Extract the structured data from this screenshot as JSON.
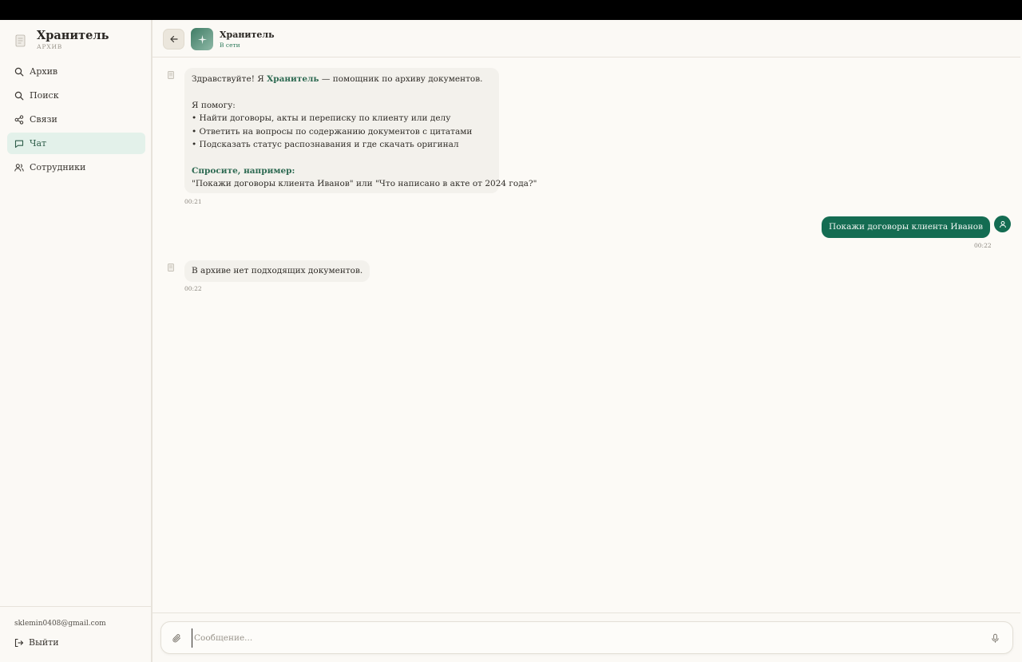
{
  "sidebar": {
    "brand_title": "Хранитель",
    "brand_subtitle": "АРХИВ",
    "nav": [
      {
        "label": "Архив",
        "icon": "search-icon"
      },
      {
        "label": "Поиск",
        "icon": "search-icon"
      },
      {
        "label": "Связи",
        "icon": "share-nodes-icon"
      },
      {
        "label": "Чат",
        "icon": "chat-bubble-icon",
        "active": true
      },
      {
        "label": "Сотрудники",
        "icon": "users-icon"
      }
    ],
    "user_email": "sklemin0408@gmail.com",
    "logout_label": "Выйти"
  },
  "header": {
    "bot_name": "Хранитель",
    "bot_status": "В сети"
  },
  "messages": [
    {
      "from": "bot",
      "greeting_start": "Здравствуйте! Я ",
      "greeting_name": "Хранитель",
      "greeting_end": " — помощник по архиву документов.",
      "intro": "Я помогу:",
      "bullets": [
        "• Найти договоры, акты и переписку по клиенту или делу",
        "• Ответить на вопросы по содержанию документов с цитатами",
        "• Подсказать статус распознавания и где скачать оригинал"
      ],
      "ask_title": "Спросите, например:",
      "ask_example": "\"Покажи договоры клиента Иванов\" или \"Что написано в акте от 2024 года?\"",
      "time": "00:21"
    },
    {
      "from": "user",
      "text": "Покажи договоры клиента Иванов",
      "time": "00:22"
    },
    {
      "from": "bot",
      "text": "В архиве нет подходящих документов.",
      "time": "00:22"
    }
  ],
  "composer": {
    "placeholder": "Сообщение..."
  },
  "colors": {
    "accent": "#146c52",
    "background": "#fcfaf6",
    "active_nav": "#e3f1ea"
  }
}
